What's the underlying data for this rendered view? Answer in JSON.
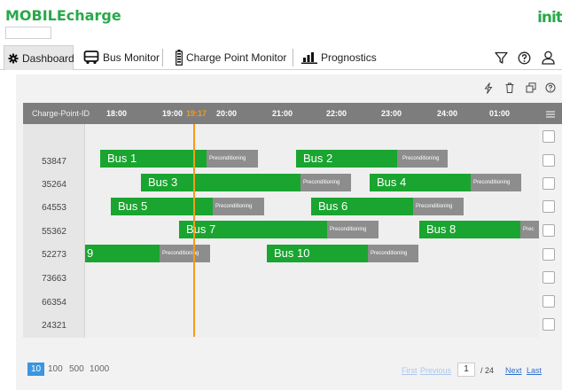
{
  "header": {
    "brand": "MOBILEcharge",
    "logo": "init"
  },
  "nav": {
    "tabs": [
      {
        "label": "Dashboard",
        "icon": "gear-icon",
        "active": true
      },
      {
        "label": "Bus Monitor",
        "icon": "bus-icon"
      },
      {
        "label": "Charge Point Monitor",
        "icon": "battery-icon"
      },
      {
        "label": "Prognostics",
        "icon": "bar-chart-icon"
      }
    ],
    "right_icons": [
      "filter-icon",
      "help-icon",
      "user-icon"
    ]
  },
  "toolbar": {
    "icons": [
      "lightning-icon",
      "trash-icon",
      "copy-icon",
      "help-icon"
    ]
  },
  "grid": {
    "id_header": "Charge-Point-ID",
    "ticks": [
      "18:00",
      "19:00",
      "20:00",
      "21:00",
      "22:00",
      "23:00",
      "24:00",
      "01:00"
    ],
    "current_time": "19:17",
    "filter_value": "",
    "rows": [
      {
        "id": "53847",
        "bars": [
          {
            "label": "Bus 1",
            "pre": "Preconditioning"
          },
          {
            "label": "Bus 2",
            "pre": "Preconditioning"
          }
        ]
      },
      {
        "id": "35264",
        "bars": [
          {
            "label": "Bus 3",
            "pre": "Preconditioning"
          },
          {
            "label": "Bus 4",
            "pre": "Preconditioning"
          }
        ]
      },
      {
        "id": "64553",
        "bars": [
          {
            "label": "Bus 5",
            "pre": "Preconditioning"
          },
          {
            "label": "Bus 6",
            "pre": "Preconditioning"
          }
        ]
      },
      {
        "id": "55362",
        "bars": [
          {
            "label": "Bus 7",
            "pre": "Preconditioning"
          },
          {
            "label": "Bus 8",
            "pre": "Prec"
          }
        ]
      },
      {
        "id": "52273",
        "bars": [
          {
            "label": "9",
            "pre": "Preconditioning"
          },
          {
            "label": "Bus 10",
            "pre": "Preconditioning"
          }
        ]
      },
      {
        "id": "73663",
        "bars": []
      },
      {
        "id": "66354",
        "bars": []
      },
      {
        "id": "24321",
        "bars": []
      }
    ]
  },
  "pagination": {
    "sizes": [
      "10",
      "100",
      "500",
      "1000"
    ],
    "selected_size": "10",
    "first": "First",
    "previous": "Previous",
    "page": "1",
    "of": "/ 24",
    "next": "Next",
    "last": "Last"
  },
  "colors": {
    "brand": "#2aa84a",
    "bus_bar": "#19a530",
    "preconditioning": "#8d8d8d",
    "now_line": "#f39c1b",
    "page_active": "#3b95e0"
  }
}
